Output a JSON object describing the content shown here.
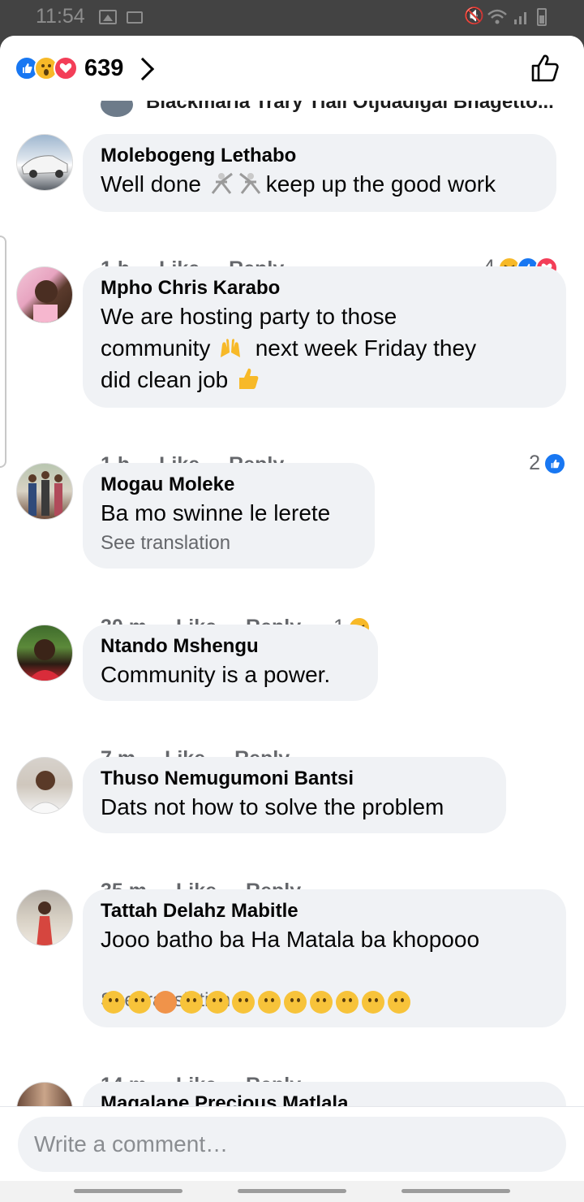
{
  "status": {
    "time": "11:54"
  },
  "header": {
    "reaction_count": "639",
    "reactions": [
      "like-icon",
      "wow-icon",
      "love-icon"
    ]
  },
  "cut_off": {
    "name": "Blackmaria Trary Tlali Otjuadigal Bnagetto..."
  },
  "comments": [
    {
      "author": "Molebogeng Lethabo",
      "text_a": "Well done",
      "text_b": "keep up the good work",
      "time": "1 h",
      "like": "Like",
      "reply": "Reply",
      "reaction_count": "4",
      "reactions": [
        "haha-icon",
        "like-icon",
        "love-icon"
      ]
    },
    {
      "author": "Mpho Chris Karabo",
      "text_line1": "We are hosting party to those",
      "text_line2a": "community",
      "text_line2b": "next week Friday they",
      "text_line3": "did clean job",
      "time": "1 h",
      "like": "Like",
      "reply": "Reply",
      "reaction_count": "2",
      "reactions": [
        "like-icon"
      ]
    },
    {
      "author": "Mogau Moleke",
      "text": "Ba mo swinne le lerete",
      "see_translation": "See translation",
      "time": "30 m",
      "like": "Like",
      "reply": "Reply",
      "reaction_count": "1",
      "reactions": [
        "haha-icon"
      ]
    },
    {
      "author": "Ntando Mshengu",
      "text": "Community is a power.",
      "time": "7 m",
      "like": "Like",
      "reply": "Reply"
    },
    {
      "author": "Thuso Nemugumoni Bantsi",
      "text": "Dats not how to solve the problem",
      "time": "35 m",
      "like": "Like",
      "reply": "Reply"
    },
    {
      "author": "Tattah Delahz Mabitle",
      "text": "Jooo batho ba Ha Matala ba khopooo",
      "see_translation": "See translation",
      "time": "14 m",
      "like": "Like",
      "reply": "Reply"
    },
    {
      "author": "Magalane Precious Matlala"
    }
  ],
  "composer": {
    "placeholder": "Write a comment…"
  },
  "colors": {
    "like": "#1877f2",
    "love": "#f33e58",
    "haha": "#f7b928",
    "bubble": "#f0f2f5",
    "meta": "#65676b"
  }
}
